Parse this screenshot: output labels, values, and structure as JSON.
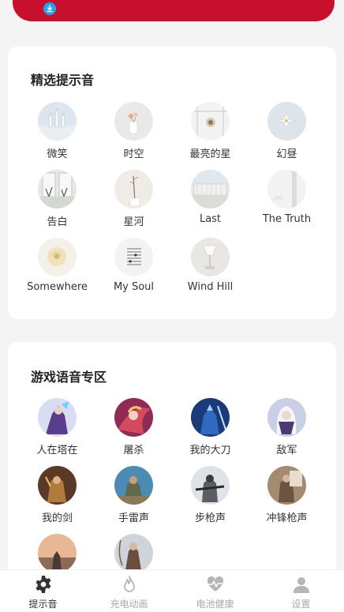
{
  "featured": {
    "title": "精选提示音",
    "items": [
      {
        "label": "微笑",
        "thumb": "cathedral-scene"
      },
      {
        "label": "时空",
        "thumb": "flower-vase-scene"
      },
      {
        "label": "最亮的星",
        "thumb": "window-flower-scene"
      },
      {
        "label": "幻昼",
        "thumb": "white-flower-scene"
      },
      {
        "label": "告白",
        "thumb": "window-plants-scene"
      },
      {
        "label": "星河",
        "thumb": "dried-stem-scene"
      },
      {
        "label": "Last",
        "thumb": "building-sky-scene"
      },
      {
        "label": "The Truth",
        "thumb": "white-room-scene"
      },
      {
        "label": "Somewhere",
        "thumb": "cream-rose-scene"
      },
      {
        "label": "My Soul",
        "thumb": "music-notes-scene"
      },
      {
        "label": "Wind Hill",
        "thumb": "lamp-scene"
      }
    ]
  },
  "game": {
    "title": "游戏语音专区",
    "items": [
      {
        "label": "人在塔在",
        "thumb": "mage-character"
      },
      {
        "label": "屠杀",
        "thumb": "red-warrior-character"
      },
      {
        "label": "我的大刀",
        "thumb": "blue-knight-character"
      },
      {
        "label": "敌军",
        "thumb": "white-hair-character"
      },
      {
        "label": "我的剑",
        "thumb": "golden-warrior-character"
      },
      {
        "label": "手雷声",
        "thumb": "soldier-character"
      },
      {
        "label": "步枪声",
        "thumb": "rifle-soldier-character"
      },
      {
        "label": "冲锋枪声",
        "thumb": "gunner-character"
      },
      {
        "label": "",
        "thumb": "sunset-character"
      },
      {
        "label": "",
        "thumb": "archer-character"
      }
    ]
  },
  "nav": [
    {
      "label": "提示音",
      "icon": "gear-icon",
      "active": true
    },
    {
      "label": "充电动画",
      "icon": "flame-icon",
      "active": false
    },
    {
      "label": "电池健康",
      "icon": "heartbeat-icon",
      "active": false
    },
    {
      "label": "设置",
      "icon": "user-icon",
      "active": false
    }
  ],
  "colors": {
    "banner": "#c8102e",
    "download_badge": "#1ea7f0",
    "background": "#f4f4f4"
  }
}
